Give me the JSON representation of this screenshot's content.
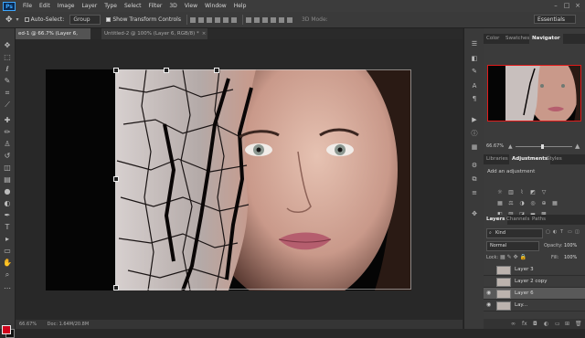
{
  "menubar": {
    "logo": "Ps",
    "items": [
      "File",
      "Edit",
      "Image",
      "Layer",
      "Type",
      "Select",
      "Filter",
      "3D",
      "View",
      "Window",
      "Help"
    ]
  },
  "options": {
    "auto_select": "Auto-Select:",
    "group": "Group",
    "show_transform": "Show Transform Controls",
    "mode_3d": "3D Mode:",
    "workspace": "Essentials"
  },
  "tabs": [
    {
      "label": "ed-1 @ 66.7% (Layer 6, RGB/8) *",
      "active": true
    },
    {
      "label": "Untitled-2 @ 100% (Layer 6, RGB/8) *",
      "active": false
    }
  ],
  "statusbar": {
    "zoom": "66.67%",
    "doc": "Doc: 1.64M/20.8M"
  },
  "panels": {
    "top_tabs": [
      "Color",
      "Swatches",
      "Navigator"
    ],
    "nav_zoom": "66.67%",
    "adj_tabs": [
      "Libraries",
      "Adjustments",
      "Styles"
    ],
    "add_adjustment": "Add an adjustment",
    "layer_tabs": [
      "Layers",
      "Channels",
      "Paths"
    ],
    "kind_filter": "Kind",
    "blend_mode": "Normal",
    "opacity_label": "Opacity:",
    "opacity_value": "100%",
    "lock_label": "Lock:",
    "fill_label": "Fill:",
    "fill_value": "100%",
    "layers": [
      {
        "name": "Layer 3",
        "visible": false,
        "selected": false
      },
      {
        "name": "Layer 2 copy",
        "visible": false,
        "selected": false
      },
      {
        "name": "Layer 6",
        "visible": true,
        "selected": true
      },
      {
        "name": "Lay...",
        "visible": true,
        "selected": false
      }
    ]
  },
  "colors": {
    "accent_red": "#d0021b",
    "panel_bg": "#3b3b3b",
    "workspace_bg": "#282828"
  }
}
